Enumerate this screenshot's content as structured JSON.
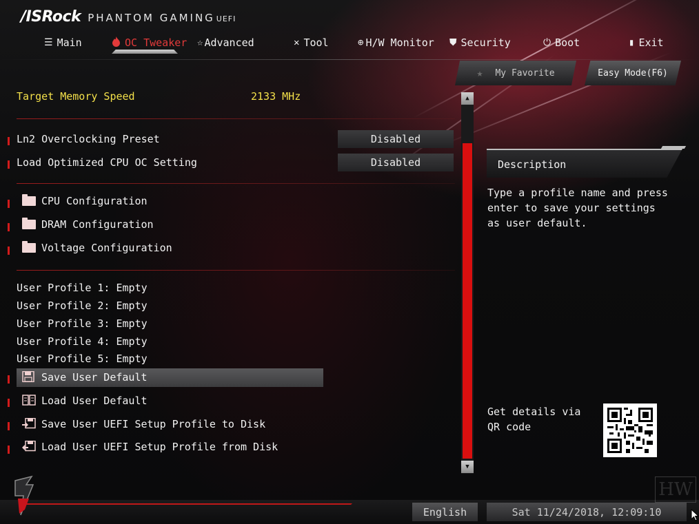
{
  "header": {
    "brand": "/ISRock",
    "subtitle": "PHANTOM GAMING",
    "uefi": "UEFI"
  },
  "nav": [
    {
      "label": "Main",
      "icon": "list-icon"
    },
    {
      "label": "OC Tweaker",
      "icon": "flame-icon",
      "active": true
    },
    {
      "label": "Advanced",
      "icon": "star-icon"
    },
    {
      "label": "Tool",
      "icon": "tools-icon"
    },
    {
      "label": "H/W Monitor",
      "icon": "crosshair-icon"
    },
    {
      "label": "Security",
      "icon": "shield-icon"
    },
    {
      "label": "Boot",
      "icon": "power-icon"
    },
    {
      "label": "Exit",
      "icon": "exit-icon"
    }
  ],
  "buttons": {
    "favorite": "My Favorite",
    "easy_mode": "Easy Mode(F6)"
  },
  "settings": {
    "target_memory_label": "Target Memory Speed",
    "target_memory_value": "2133 MHz",
    "ln2_label": "Ln2 Overclocking Preset",
    "ln2_value": "Disabled",
    "load_cpu_oc_label": "Load Optimized CPU OC Setting",
    "load_cpu_oc_value": "Disabled"
  },
  "submenus": [
    "CPU Configuration",
    "DRAM Configuration",
    "Voltage Configuration"
  ],
  "profiles": [
    "User Profile 1: Empty",
    "User Profile 2: Empty",
    "User Profile 3: Empty",
    "User Profile 4: Empty",
    "User Profile 5: Empty"
  ],
  "actions": [
    "Save User Default",
    "Load User Default",
    "Save User UEFI Setup Profile to Disk",
    "Load User UEFI Setup Profile from Disk"
  ],
  "description": {
    "title": "Description",
    "text": "Type a profile name and press enter to save your settings as user default.",
    "qr_text": "Get details via QR code"
  },
  "footer": {
    "language": "English",
    "datetime": "Sat 11/24/2018, 12:09:10",
    "watermark": "HW"
  },
  "colors": {
    "accent_red": "#d90f0f",
    "highlight_yellow": "#f3e04a"
  }
}
